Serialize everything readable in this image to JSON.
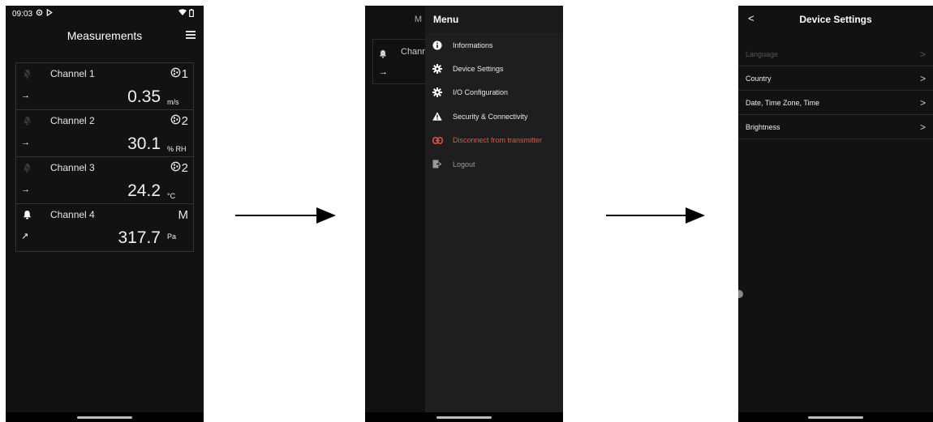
{
  "screen1": {
    "status": {
      "time": "09:03"
    },
    "header": {
      "title": "Measurements"
    },
    "channels": [
      {
        "name": "Channel 1",
        "source": "1",
        "source_icon": "probe-icon",
        "value": "0.35",
        "unit": "m/s",
        "trend": "→",
        "alarm": false
      },
      {
        "name": "Channel 2",
        "source": "2",
        "source_icon": "probe-icon",
        "value": "30.1",
        "unit": "% RH",
        "trend": "→",
        "alarm": false
      },
      {
        "name": "Channel 3",
        "source": "2",
        "source_icon": "probe-icon",
        "value": "24.2",
        "unit": "°C",
        "trend": "→",
        "alarm": false
      },
      {
        "name": "Channel 4",
        "source": "M",
        "source_icon": "",
        "value": "317.7",
        "unit": "Pa",
        "trend": "↗",
        "alarm": true
      }
    ]
  },
  "screen2": {
    "under_title": "M",
    "under_channel": "Chann",
    "under_trend": "→",
    "menu": {
      "title": "Menu",
      "items": [
        {
          "label": "Informations",
          "icon": "info-icon",
          "style": "normal"
        },
        {
          "label": "Device Settings",
          "icon": "gear-icon",
          "style": "normal"
        },
        {
          "label": "I/O Configuration",
          "icon": "gear-icon",
          "style": "normal"
        },
        {
          "label": "Security & Connectivity",
          "icon": "warning-icon",
          "style": "normal"
        },
        {
          "label": "Disconnect from transmitter",
          "icon": "link-icon",
          "style": "danger"
        },
        {
          "label": "Logout",
          "icon": "logout-icon",
          "style": "muted"
        }
      ]
    }
  },
  "screen3": {
    "header": {
      "back": "<",
      "title": "Device Settings"
    },
    "items": [
      {
        "label": "Language",
        "chevron": ">",
        "enabled": false
      },
      {
        "label": "Country",
        "chevron": ">",
        "enabled": true
      },
      {
        "label": "Date, Time Zone, Time",
        "chevron": ">",
        "enabled": true
      },
      {
        "label": "Brightness",
        "chevron": ">",
        "enabled": true
      }
    ]
  },
  "colors": {
    "background": "#121212",
    "danger": "#e8553e",
    "text": "#ffffff",
    "arrow": "#000000"
  }
}
